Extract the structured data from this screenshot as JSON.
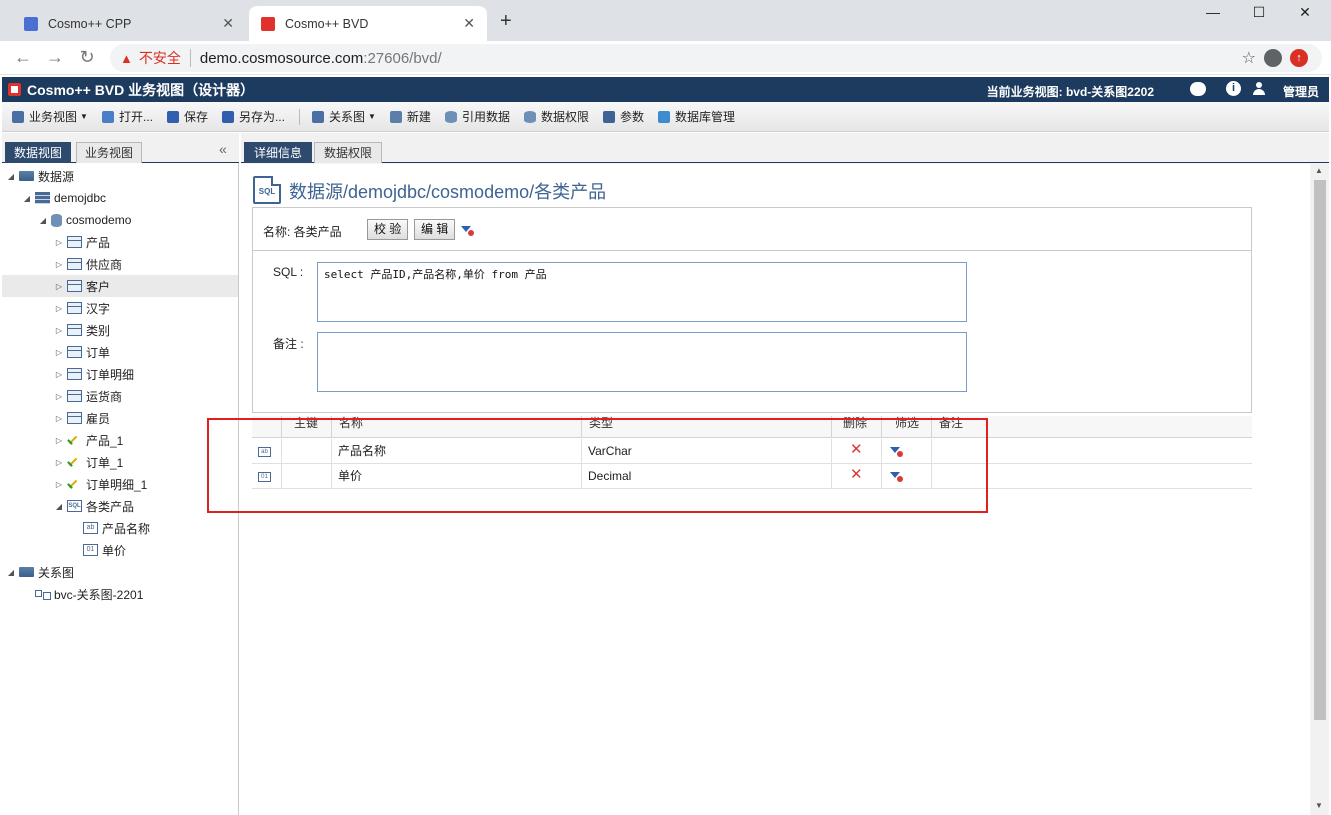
{
  "browser": {
    "tabs": [
      {
        "title": "Cosmo++ CPP",
        "active": false
      },
      {
        "title": "Cosmo++ BVD",
        "active": true
      }
    ],
    "new_tab": "+",
    "not_secure": "不安全",
    "url_host": "demo.cosmosource.com",
    "url_path": ":27606/bvd/"
  },
  "app": {
    "title": "Cosmo++ BVD 业务视图（设计器）",
    "current_view": "当前业务视图: bvd-关系图2202",
    "user": "管理员"
  },
  "toolbar": {
    "business_view": "业务视图",
    "open": "打开...",
    "save": "保存",
    "save_as": "另存为...",
    "relation": "关系图",
    "new": "新建",
    "ref_data": "引用数据",
    "data_perm": "数据权限",
    "params": "参数",
    "db_manage": "数据库管理"
  },
  "left": {
    "tabs": [
      "数据视图",
      "业务视图"
    ],
    "tree": {
      "datasource": "数据源",
      "server": "demojdbc",
      "db": "cosmodemo",
      "tables": [
        "产品",
        "供应商",
        "客户",
        "汉字",
        "类别",
        "订单",
        "订单明细",
        "运货商",
        "雇员"
      ],
      "queries": [
        "产品_1",
        "订单_1",
        "订单明细_1"
      ],
      "sql_node": "各类产品",
      "fields": [
        {
          "icon": "ab",
          "label": "产品名称"
        },
        {
          "icon": "01",
          "label": "单价"
        }
      ],
      "relation_root": "关系图",
      "relation_item": "bvc-关系图-2201"
    }
  },
  "right": {
    "tabs": [
      "详细信息",
      "数据权限"
    ],
    "page_title": "数据源/demojdbc/cosmodemo/各类产品",
    "page_icon_text": "SQL",
    "name_label": "名称: 各类产品",
    "validate_btn": "校 验",
    "edit_btn": "编 辑",
    "sql_label": "SQL :",
    "sql_text": "select 产品ID,产品名称,单价 from 产品",
    "note_label": "备注 :",
    "grid": {
      "headers": [
        "主键",
        "名称",
        "类型",
        "删除",
        "筛选",
        "备注"
      ],
      "rows": [
        {
          "icon": "ab",
          "name": "产品名称",
          "type": "VarChar"
        },
        {
          "icon": "01",
          "name": "单价",
          "type": "Decimal"
        }
      ]
    }
  },
  "colors": {
    "header_bg": "#1d3a5f",
    "accent": "#3e6493",
    "highlight": "#e02020",
    "danger": "#d83a3a"
  }
}
